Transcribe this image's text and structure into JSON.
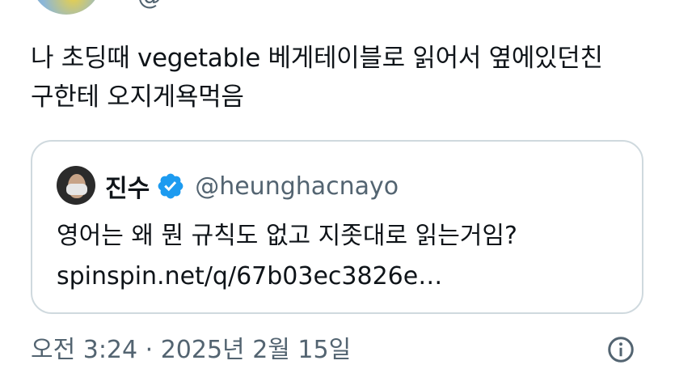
{
  "author": {
    "handle_partial": "@"
  },
  "tweet": {
    "lines": [
      "나 초딩때 vegetable 베게테이블로 읽어서 옆에있던친",
      "구한테 오지게욕먹음"
    ]
  },
  "quote": {
    "name": "진수",
    "handle": "@heunghacnayo",
    "lines": [
      "영어는 왜 뭔 규칙도 없고 지좃대로 읽는거임?",
      "spinspin.net/q/67b03ec3826e…"
    ],
    "verified_color": "#1d9bf0"
  },
  "meta": {
    "timestamp": "오전 3:24 · 2025년 2월 15일"
  },
  "icons": {
    "verified": "verified-badge-icon",
    "info": "info-icon"
  }
}
